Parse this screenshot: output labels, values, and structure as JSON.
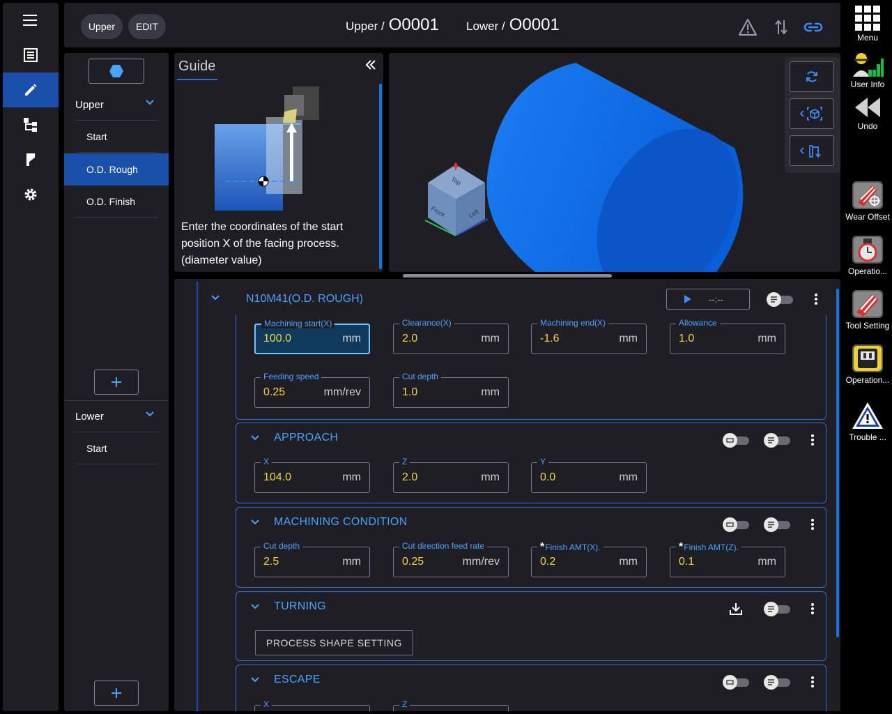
{
  "header": {
    "mode_upper": "Upper",
    "mode_edit": "EDIT",
    "upper_label": "Upper /",
    "upper_program": "O0001",
    "lower_label": "Lower /",
    "lower_program": "O0001"
  },
  "process_list": {
    "upper": {
      "title": "Upper",
      "items": [
        "Start",
        "O.D. Rough",
        "O.D. Finish"
      ],
      "selected": "O.D. Rough"
    },
    "lower": {
      "title": "Lower",
      "items": [
        "Start"
      ]
    }
  },
  "guide": {
    "title": "Guide",
    "text": "Enter the coordinates of the start position X of the facing process. (diameter value)"
  },
  "view": {
    "cube_faces": [
      "Top",
      "Front",
      "Left"
    ]
  },
  "right_toolbar": [
    {
      "label": "Menu",
      "icon": "grid-icon"
    },
    {
      "label": "User Info",
      "icon": "user-info-icon"
    },
    {
      "label": "Undo",
      "icon": "undo-icon"
    },
    {
      "label": "Wear Offset",
      "icon": "wear-offset-icon"
    },
    {
      "label": "Operatio...",
      "icon": "operation-timer-icon"
    },
    {
      "label": "Tool Setting",
      "icon": "tool-setting-icon"
    },
    {
      "label": "Operation...",
      "icon": "operation-panel-icon"
    },
    {
      "label": "Trouble ...",
      "icon": "trouble-warning-icon"
    }
  ],
  "process": {
    "title": "N10M41(O.D. ROUGH)",
    "time": "--:--",
    "fields_row1": [
      {
        "label": "Machining start(X)",
        "value": "100.0",
        "unit": "mm"
      },
      {
        "label": "Clearance(X)",
        "value": "2.0",
        "unit": "mm"
      },
      {
        "label": "Machining end(X)",
        "value": "-1.6",
        "unit": "mm"
      },
      {
        "label": "Allowance",
        "value": "1.0",
        "unit": "mm"
      }
    ],
    "fields_row2": [
      {
        "label": "Feeding speed",
        "value": "0.25",
        "unit": "mm/rev"
      },
      {
        "label": "Cut depth",
        "value": "1.0",
        "unit": "mm"
      }
    ]
  },
  "approach": {
    "title": "APPROACH",
    "fields": [
      {
        "label": "X",
        "value": "104.0",
        "unit": "mm"
      },
      {
        "label": "Z",
        "value": "2.0",
        "unit": "mm"
      },
      {
        "label": "Y",
        "value": "0.0",
        "unit": "mm"
      }
    ]
  },
  "machining_condition": {
    "title": "MACHINING CONDITION",
    "fields": [
      {
        "label": "Cut depth",
        "value": "2.5",
        "unit": "mm"
      },
      {
        "label": "Cut direction feed rate",
        "value": "0.25",
        "unit": "mm/rev"
      },
      {
        "label": "Finish AMT(X).",
        "value": "0.2",
        "unit": "mm"
      },
      {
        "label": "Finish AMT(Z).",
        "value": "0.1",
        "unit": "mm"
      }
    ]
  },
  "turning": {
    "title": "TURNING",
    "button": "PROCESS SHAPE SETTING"
  },
  "escape": {
    "title": "ESCAPE",
    "fields": [
      {
        "label": "X"
      },
      {
        "label": "Z"
      }
    ]
  },
  "colors": {
    "accent": "#1a4faa",
    "link": "#4aa3ff",
    "value": "#f5d44a",
    "panel": "#1e1e24"
  }
}
